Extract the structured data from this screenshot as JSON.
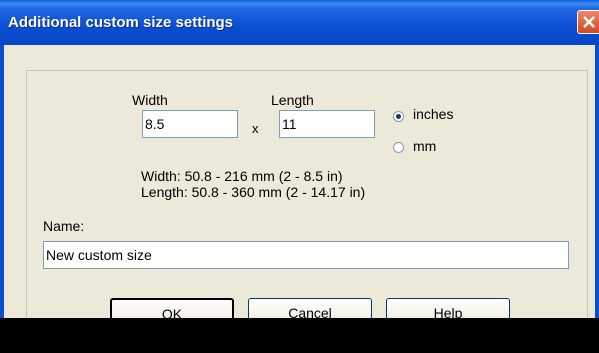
{
  "window": {
    "title": "Additional custom size settings"
  },
  "size": {
    "width_label": "Width",
    "length_label": "Length",
    "width_value": "8.5",
    "length_value": "11",
    "separator": "x",
    "units": [
      {
        "label": "inches",
        "checked": true
      },
      {
        "label": "mm",
        "checked": false
      }
    ],
    "width_range": "Width: 50.8 - 216 mm  (2 - 8.5 in)",
    "length_range": "Length: 50.8 - 360 mm  (2 - 14.17 in)"
  },
  "name": {
    "label": "Name:",
    "value": "New custom size"
  },
  "buttons": {
    "ok": "OK",
    "cancel": "Cancel",
    "help": "Help"
  }
}
